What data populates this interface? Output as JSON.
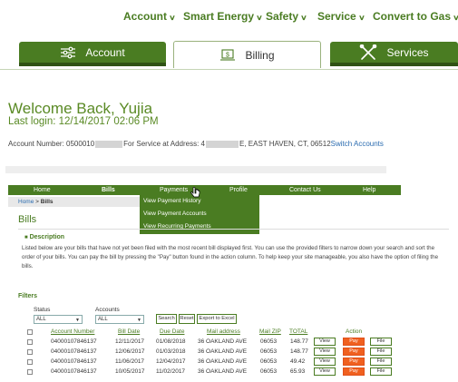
{
  "top_nav": [
    {
      "label": "Account"
    },
    {
      "label": "Smart Energy"
    },
    {
      "label": "Safety"
    },
    {
      "label": "Service"
    },
    {
      "label": "Convert to Gas"
    }
  ],
  "tabs": [
    {
      "label": "Account",
      "icon": "sliders-icon"
    },
    {
      "label": "Billing",
      "icon": "laptop-dollar-icon"
    },
    {
      "label": "Services",
      "icon": "tools-icon"
    }
  ],
  "welcome": {
    "title": "Welcome Back, Yujia",
    "last_login": "Last login: 12/14/2017 02:06 PM"
  },
  "account_line": {
    "prefix": "Account Number: 0500010",
    "mid": "For Service at Address: 4",
    "suffix": "E, EAST HAVEN, CT, 06512",
    "switch_link": "Switch Accounts"
  },
  "inner_nav": [
    {
      "label": "Home",
      "bold": false
    },
    {
      "label": "Bills",
      "bold": true
    },
    {
      "label": "Payments",
      "bold": false
    },
    {
      "label": "Profile",
      "bold": false
    },
    {
      "label": "Contact Us",
      "bold": false
    },
    {
      "label": "Help",
      "bold": false
    }
  ],
  "payments_menu": [
    {
      "label": "View Payment History"
    },
    {
      "label": "View Payment Accounts"
    },
    {
      "label": "View Recurring Payments"
    }
  ],
  "breadcrumb": {
    "home": "Home",
    "sep": " > ",
    "current": "Bills"
  },
  "page_title": "Bills",
  "description": {
    "heading": "Description",
    "text": "Listed below are your bills that have not yet been filed with the most recent bill displayed first. You can use the provided filters to narrow down your search and sort the order of your bills. You can pay the bill by pressing the \"Pay\" button found in the action column. To help keep your site manageable, you also have the option of filing the bills."
  },
  "filters": {
    "heading": "Filters",
    "status_label": "Status",
    "status_value": "ALL",
    "accounts_label": "Accounts",
    "accounts_value": "ALL",
    "search_btn": "Search",
    "reset_btn": "Reset",
    "export_btn": "Export to Excel"
  },
  "table": {
    "headers": {
      "account": "Account Number",
      "bill_date": "Bill Date",
      "due_date": "Due Date",
      "mail_address": "Mail address",
      "mail_zip": "Mail ZIP",
      "total": "TOTAL",
      "action": "Action"
    },
    "action_labels": {
      "view": "View",
      "pay": "Pay",
      "file": "File"
    },
    "rows": [
      {
        "account": "04000107846137",
        "bill_date": "12/11/2017",
        "due_date": "01/08/2018",
        "address": "36 OAKLAND AVE",
        "zip": "06053",
        "total": "148.77"
      },
      {
        "account": "04000107846137",
        "bill_date": "12/06/2017",
        "due_date": "01/03/2018",
        "address": "36 OAKLAND AVE",
        "zip": "06053",
        "total": "148.77"
      },
      {
        "account": "04000107846137",
        "bill_date": "11/06/2017",
        "due_date": "12/04/2017",
        "address": "36 OAKLAND AVE",
        "zip": "06053",
        "total": "49.42"
      },
      {
        "account": "04000107846137",
        "bill_date": "10/05/2017",
        "due_date": "11/02/2017",
        "address": "36 OAKLAND AVE",
        "zip": "06053",
        "total": "65.93"
      }
    ]
  },
  "colors": {
    "brand_green": "#4a7c22",
    "pay_orange": "#f0601f",
    "link_blue": "#2b6cb0"
  }
}
